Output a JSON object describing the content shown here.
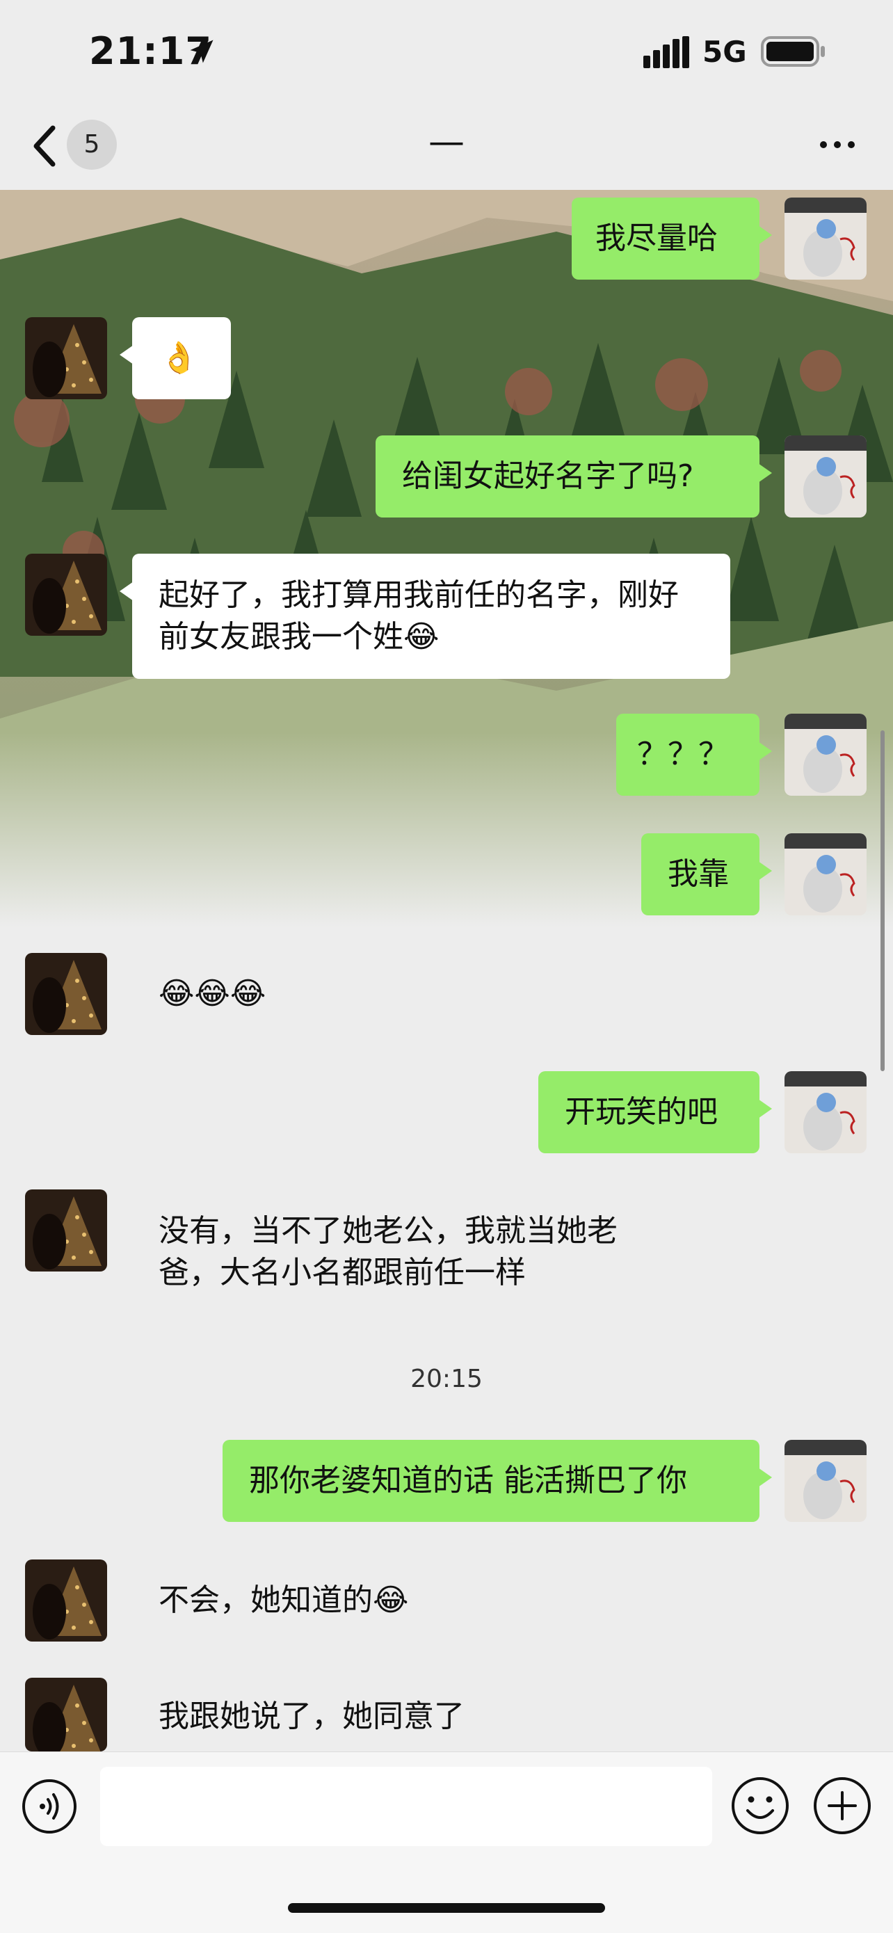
{
  "status": {
    "time": "21:17",
    "network": "5G"
  },
  "nav": {
    "unread_count": "5",
    "title": "—"
  },
  "messages": [
    {
      "side": "right",
      "text": "我尽量哈"
    },
    {
      "side": "left",
      "text": "👌"
    },
    {
      "side": "right",
      "text": "给闺女起好名字了吗?"
    },
    {
      "side": "left",
      "text": "起好了，我打算用我前任的名字，刚好前女友跟我一个姓😂"
    },
    {
      "side": "right",
      "text": "？？？"
    },
    {
      "side": "right",
      "text": "我靠"
    },
    {
      "side": "left",
      "text": "😂😂😂"
    },
    {
      "side": "right",
      "text": "开玩笑的吧"
    },
    {
      "side": "left",
      "text": "没有，当不了她老公，我就当她老爸，大名小名都跟前任一样"
    },
    {
      "side": "right",
      "text": "那你老婆知道的话 能活撕巴了你"
    },
    {
      "side": "left",
      "text": "不会，她知道的😂"
    },
    {
      "side": "left",
      "text": "我跟她说了，她同意了"
    }
  ],
  "timestamp": "20:15",
  "input": {
    "placeholder": ""
  },
  "icons": {
    "location": "location-arrow-icon",
    "signal": "signal-icon",
    "battery": "battery-icon",
    "back": "chevron-left-icon",
    "more": "more-dots-icon",
    "voice": "voice-icon",
    "emoji": "emoji-icon",
    "plus": "plus-icon"
  },
  "colors": {
    "sent_bubble": "#95ec69",
    "received_bubble": "#ffffff",
    "background": "#ededed"
  }
}
